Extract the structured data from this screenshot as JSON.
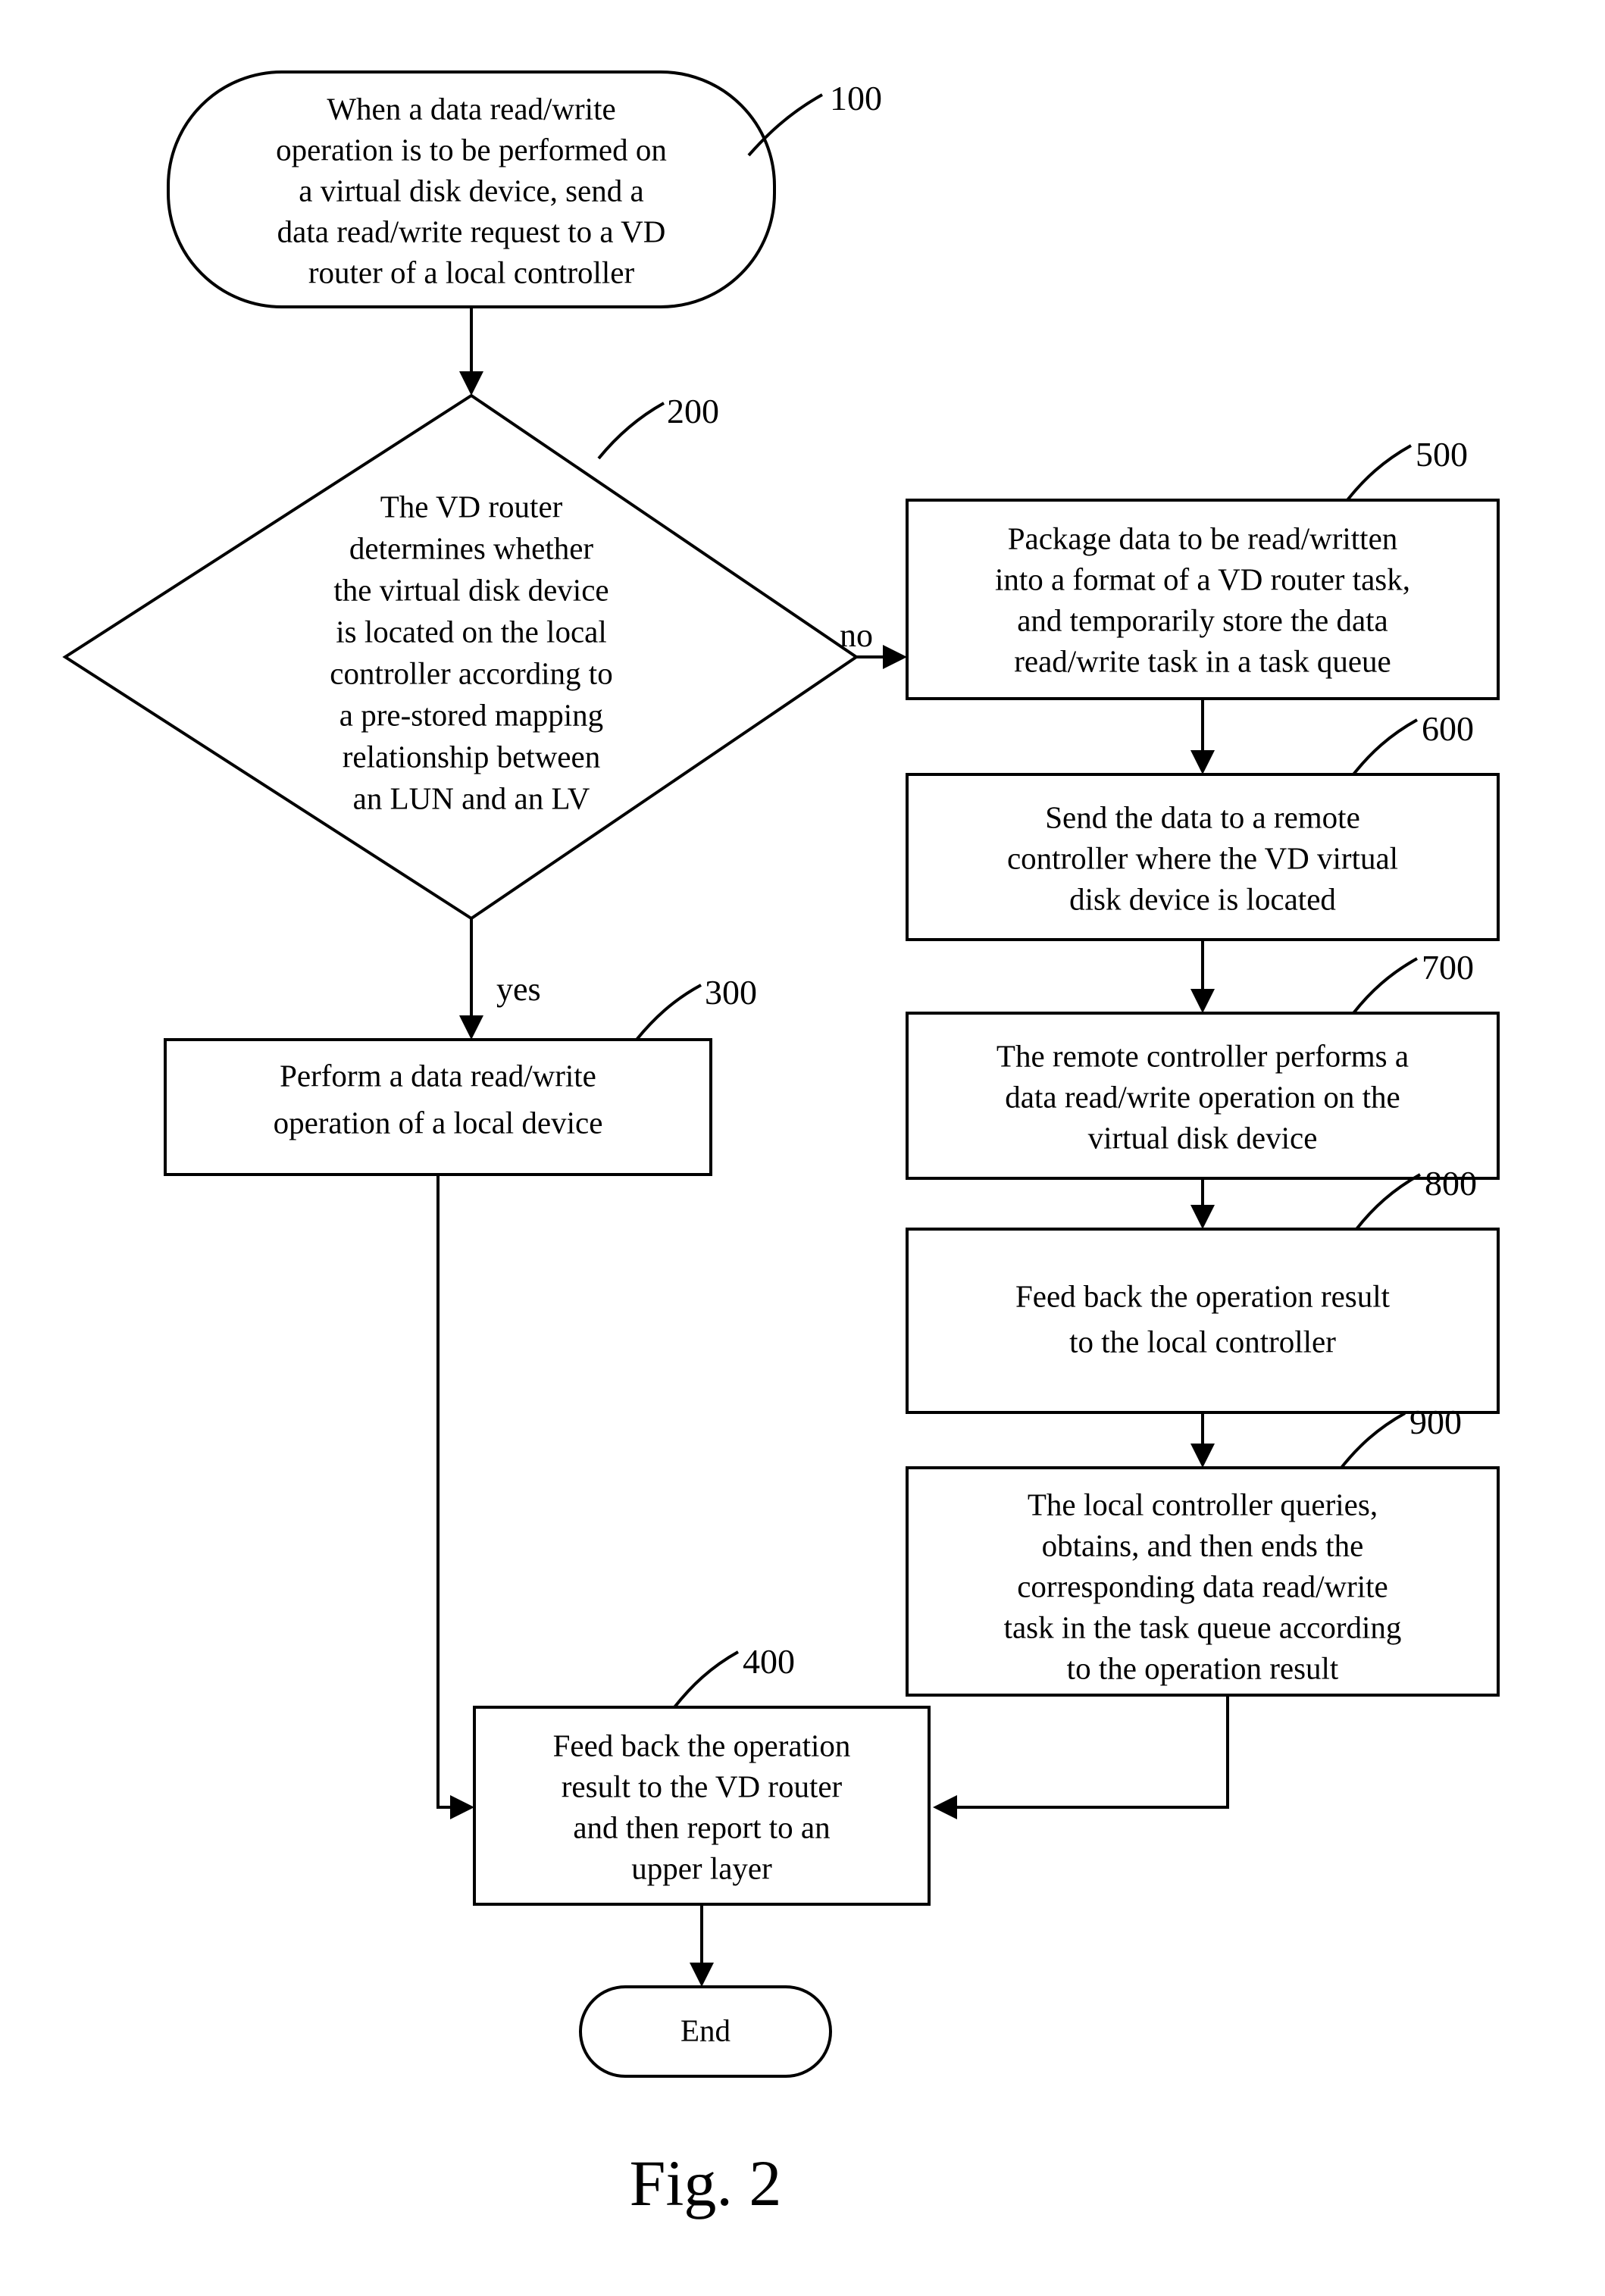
{
  "figure": {
    "caption": "Fig. 2",
    "type": "patent-flowchart"
  },
  "nodes": [
    {
      "id": "start",
      "ref": "100",
      "shape": "rounded-terminal",
      "lines": [
        "When a data read/write",
        "operation is to be performed on",
        "a virtual disk device, send a",
        "data read/write request to a VD",
        "router of a local controller"
      ]
    },
    {
      "id": "decision",
      "ref": "200",
      "shape": "diamond",
      "lines": [
        "The VD router",
        "determines whether",
        "the virtual disk device",
        "is located on the local",
        "controller according to",
        "a pre-stored mapping",
        "relationship between",
        "an LUN and an LV"
      ]
    },
    {
      "id": "local-op",
      "ref": "300",
      "shape": "rectangle",
      "lines": [
        "Perform a data read/write",
        "operation of a local device"
      ]
    },
    {
      "id": "feedback-vd-router",
      "ref": "400",
      "shape": "rectangle",
      "lines": [
        "Feed back the operation",
        "result to the VD router",
        "and then report to an",
        "upper layer"
      ]
    },
    {
      "id": "package-data",
      "ref": "500",
      "shape": "rectangle",
      "lines": [
        "Package data to be read/written",
        "into a format of a VD router task,",
        "and temporarily store the data",
        "read/write task in a task queue"
      ]
    },
    {
      "id": "send-remote",
      "ref": "600",
      "shape": "rectangle",
      "lines": [
        "Send the data to a remote",
        "controller where the VD virtual",
        "disk device is located"
      ]
    },
    {
      "id": "remote-op",
      "ref": "700",
      "shape": "rectangle",
      "lines": [
        "The remote controller performs a",
        "data read/write operation on the",
        "virtual disk device"
      ]
    },
    {
      "id": "feedback-local",
      "ref": "800",
      "shape": "rectangle",
      "lines": [
        "Feed back the operation result",
        "to the local controller"
      ]
    },
    {
      "id": "query-end-task",
      "ref": "900",
      "shape": "rectangle",
      "lines": [
        "The local controller queries,",
        "obtains, and then ends the",
        "corresponding data read/write",
        "task in the task queue according",
        "to the operation result"
      ]
    },
    {
      "id": "end",
      "ref": "",
      "shape": "rounded-terminal",
      "lines": [
        "End"
      ]
    }
  ],
  "edge_labels": {
    "yes": "yes",
    "no": "no"
  },
  "colors": {
    "stroke": "#000000",
    "fill": "#ffffff",
    "text": "#000000"
  }
}
